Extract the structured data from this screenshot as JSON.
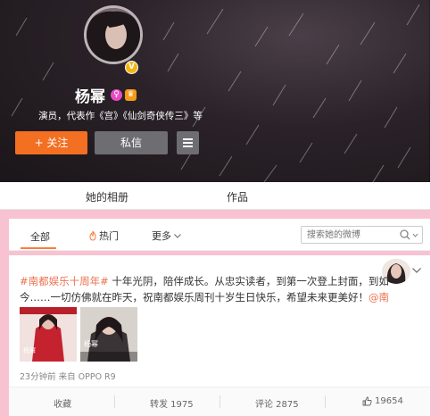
{
  "profile": {
    "name": "杨幂",
    "bio": "演员，代表作《宫》《仙剑奇侠传三》等",
    "verified_badge": "V",
    "follow_button": "+ 关注",
    "message_button": "私信"
  },
  "profile_tabs": [
    "她的相册",
    "作品"
  ],
  "filter": {
    "all": "全部",
    "hot": "热门",
    "more": "更多",
    "search_placeholder": "搜索她的微博"
  },
  "post": {
    "hashtag": "#南都娱乐十周年#",
    "text": " 十年光阴，陪伴成长。从忠实读者，到第一次登上封面，到如今……一切仿佛就在昨天，祝南都娱乐周刊十岁生日快乐，希望未来更美好！",
    "mention": "@南都娱乐周刊",
    "meta": "23分钟前 来自 OPPO R9",
    "thumb1_text": "杨幂",
    "thumb2_text": "杨幂",
    "actions": {
      "favorite": "收藏",
      "repost": "转发 1975",
      "comment": "评论 2875",
      "like": "19654"
    }
  },
  "colors": {
    "accent": "#f36f22",
    "link": "#eb7350",
    "page_bg": "#f7c3d3"
  }
}
